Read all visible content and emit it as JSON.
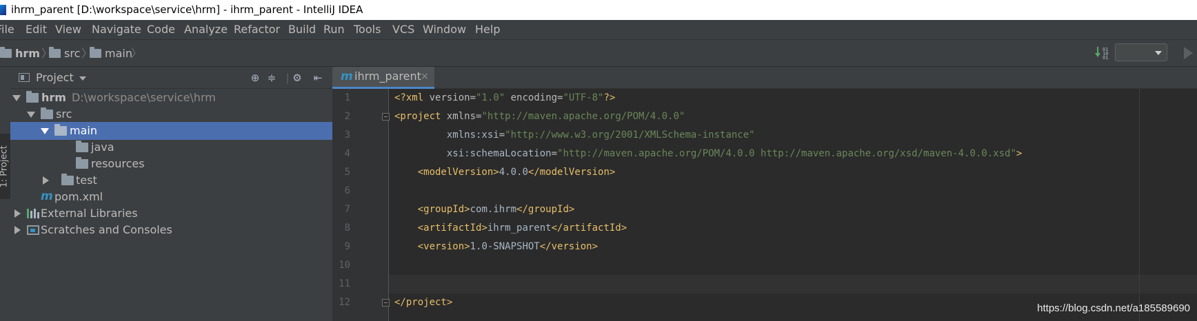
{
  "window": {
    "title": "ihrm_parent [D:\\workspace\\service\\hrm] - ihrm_parent - IntelliJ IDEA"
  },
  "menu": [
    "File",
    "Edit",
    "View",
    "Navigate",
    "Code",
    "Analyze",
    "Refactor",
    "Build",
    "Run",
    "Tools",
    "VCS",
    "Window",
    "Help"
  ],
  "breadcrumb": [
    "hrm",
    "src",
    "main"
  ],
  "sidebar": {
    "tool_window_label": "1: Project"
  },
  "project_panel": {
    "header": "Project",
    "tree": [
      {
        "label": "hrm",
        "path": "D:\\workspace\\service\\hrm",
        "icon": "module-folder-icon",
        "expanded": true
      },
      {
        "label": "src",
        "icon": "folder-icon",
        "expanded": true
      },
      {
        "label": "main",
        "icon": "folder-icon",
        "expanded": true,
        "selected": true
      },
      {
        "label": "java",
        "icon": "folder-icon"
      },
      {
        "label": "resources",
        "icon": "folder-icon"
      },
      {
        "label": "test",
        "icon": "folder-icon",
        "expanded": false
      },
      {
        "label": "pom.xml",
        "icon": "maven-icon"
      },
      {
        "label": "External Libraries",
        "icon": "library-icon",
        "expanded": false
      },
      {
        "label": "Scratches and Consoles",
        "icon": "scratch-icon",
        "expanded": false
      }
    ]
  },
  "editor": {
    "tab": {
      "label": "ihrm_parent",
      "close": "×"
    },
    "line_numbers": [
      "1",
      "2",
      "3",
      "4",
      "5",
      "6",
      "7",
      "8",
      "9",
      "10",
      "11",
      "12"
    ],
    "lines": [
      "<?xml version=\"1.0\" encoding=\"UTF-8\"?>",
      "<project xmlns=\"http://maven.apache.org/POM/4.0.0\"",
      "         xmlns:xsi=\"http://www.w3.org/2001/XMLSchema-instance\"",
      "         xsi:schemaLocation=\"http://maven.apache.org/POM/4.0.0 http://maven.apache.org/xsd/maven-4.0.0.xsd\">",
      "    <modelVersion>4.0.0</modelVersion>",
      "",
      "    <groupId>com.ihrm</groupId>",
      "    <artifactId>ihrm_parent</artifactId>",
      "    <version>1.0-SNAPSHOT</version>",
      "",
      "",
      "</project>"
    ]
  },
  "watermark": "https://blog.csdn.net/a185589690",
  "colors": {
    "selection": "#4b6eaf",
    "tag": "#e8bf6a",
    "string": "#6a8759",
    "background": "#2b2b2b"
  }
}
